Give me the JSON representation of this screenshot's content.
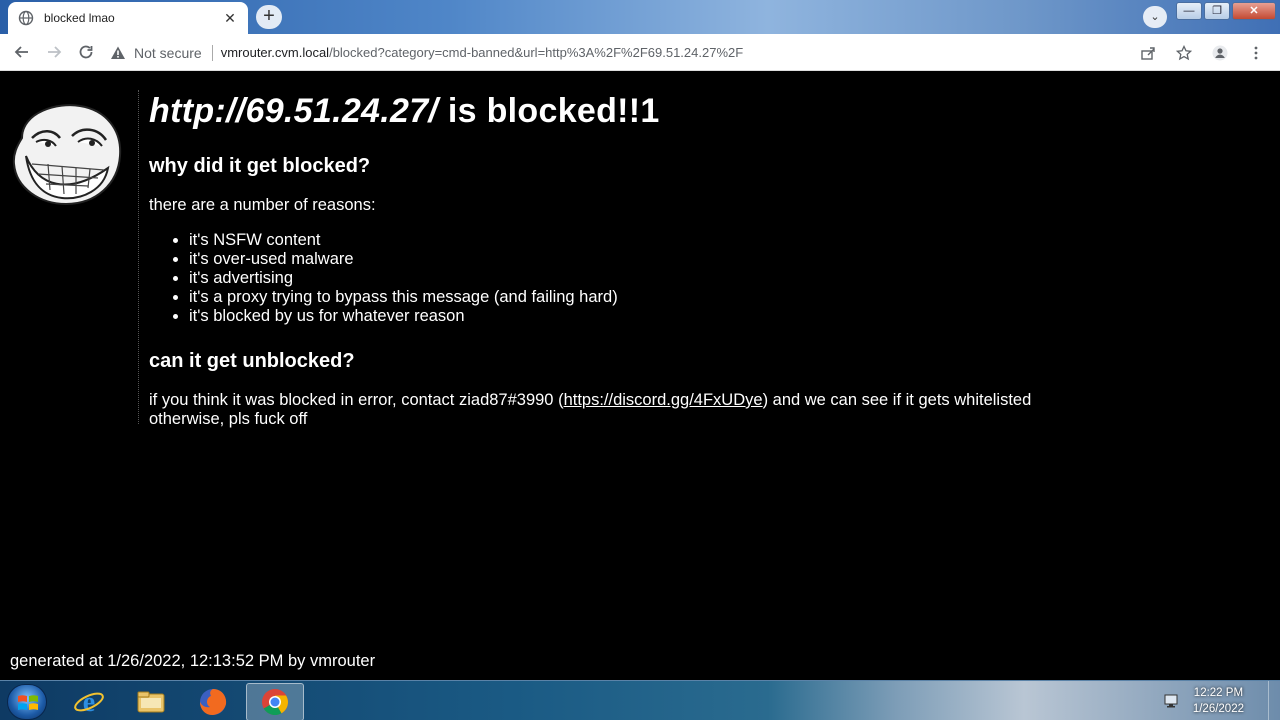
{
  "browser": {
    "tab": {
      "title": "blocked lmao",
      "close": "✕"
    },
    "newtab": "+",
    "tabsearch": "⌄",
    "window_controls": {
      "minimize": "—",
      "maximize": "❐",
      "close": "✕"
    },
    "security_label": "Not secure",
    "url": {
      "host": "vmrouter.cvm.local",
      "path": "/blocked?category=cmd-banned&url=http%3A%2F%2F69.51.24.27%2F"
    }
  },
  "page": {
    "heading_url": "http://69.51.24.27/",
    "heading_suffix": " is blocked!!1",
    "why_heading": "why did it get blocked?",
    "reasons_intro": "there are a number of reasons:",
    "reasons": [
      "it's NSFW content",
      "it's over-used malware",
      "it's advertising",
      "it's a proxy trying to bypass this message (and failing hard)",
      "it's blocked by us for whatever reason"
    ],
    "unblock_heading": "can it get unblocked?",
    "unblock_text_before": "if you think it was blocked in error, contact ziad87#3990 (",
    "unblock_link": "https://discord.gg/4FxUDye",
    "unblock_text_after": ") and we can see if it gets whitelisted",
    "unblock_line2": "otherwise, pls fuck off",
    "footer": "generated at 1/26/2022, 12:13:52 PM by vmrouter"
  },
  "taskbar": {
    "apps": [
      "internet-explorer-icon",
      "file-explorer-icon",
      "firefox-icon",
      "chrome-icon"
    ],
    "clock_time": "12:22 PM",
    "clock_date": "1/26/2022"
  }
}
